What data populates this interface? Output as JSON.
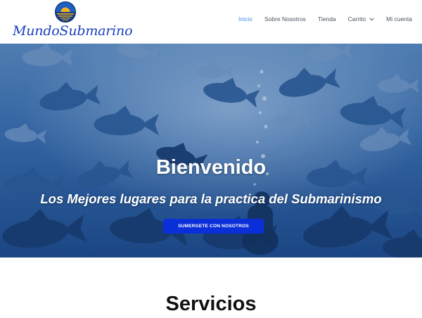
{
  "brand": {
    "name": "MundoSubmarino"
  },
  "nav": {
    "items": [
      {
        "label": "Inicio",
        "active": true
      },
      {
        "label": "Sobre Nosotros",
        "active": false
      },
      {
        "label": "Tienda",
        "active": false
      },
      {
        "label": "Carrito",
        "active": false,
        "has_dropdown": true
      },
      {
        "label": "Mi cuenta",
        "active": false
      }
    ]
  },
  "hero": {
    "title": "Bienvenido",
    "subtitle": "Los Mejores lugares para la practica del Submarinismo",
    "button_label": "SUMERGETE CON NOSOTROS"
  },
  "services": {
    "title": "Servicios"
  },
  "colors": {
    "brand_blue": "#1b3fbf",
    "nav_active": "#3f8ee8",
    "nav_text": "#4a5560",
    "cta_blue": "#0a2fd9",
    "hero_tint": "#3b6fb0"
  },
  "icons": {
    "logo": "sunset-sea-emblem",
    "dropdown": "chevron-down-icon"
  }
}
